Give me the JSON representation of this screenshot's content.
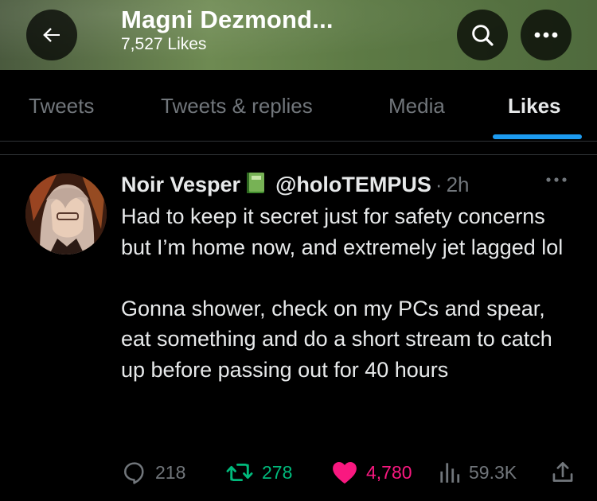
{
  "header": {
    "title": "Magni Dezmond...",
    "subtitle": "7,527 Likes",
    "back_icon": "arrow-left-icon",
    "search_icon": "search-icon",
    "more_icon": "more-horizontal-icon"
  },
  "tabs": [
    {
      "label": "Tweets",
      "active": false
    },
    {
      "label": "Tweets & replies",
      "active": false
    },
    {
      "label": "Media",
      "active": false
    },
    {
      "label": "Likes",
      "active": true
    }
  ],
  "tweet": {
    "author_name": "Noir Vesper",
    "author_badge_icon": "book-emoji-icon",
    "handle": "@holoTEMPUS",
    "separator": "·",
    "time": "2h",
    "text": "Had to keep it secret just for safety concerns but I’m home now, and extremely jet lagged lol\n\nGonna shower, check on my PCs and spear, eat something and do a short stream to catch up before passing out for 40 hours",
    "actions": {
      "replies": "218",
      "retweets": "278",
      "likes": "4,780",
      "views": "59.3K"
    }
  },
  "colors": {
    "accent": "#1d9bf0",
    "retweet": "#00ba7c",
    "like": "#f91880",
    "muted": "#71767b",
    "text": "#e7e9ea",
    "background": "#000000"
  }
}
